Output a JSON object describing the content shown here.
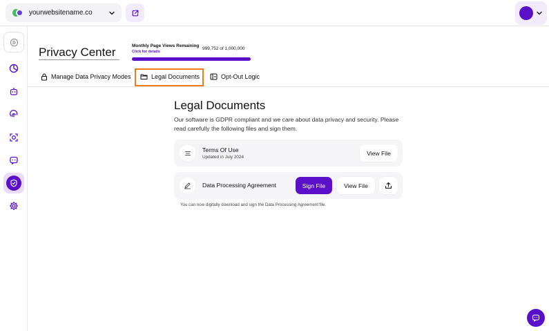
{
  "topbar": {
    "site_name": "yourwebsitename.co",
    "site_logo_icon": "two-circles-logo",
    "site_dropdown_icon": "chevron-down-icon",
    "external_link_icon": "external-link-icon",
    "account_dropdown_icon": "chevron-down-icon"
  },
  "sidebar": {
    "items": [
      {
        "icon": "collapse-icon"
      },
      {
        "icon": "pie-chart-icon"
      },
      {
        "icon": "robot-icon"
      },
      {
        "icon": "fingerprint-icon"
      },
      {
        "icon": "scan-icon"
      },
      {
        "icon": "chat-icon"
      },
      {
        "icon": "shield-check-icon",
        "active": true
      },
      {
        "icon": "gear-icon"
      }
    ]
  },
  "header": {
    "title": "Privacy Center",
    "page_views_label": "Monthly Page Views Remaining",
    "page_views_link": "Click for details",
    "page_views_count": "999,752 of 1,000,000",
    "page_views_fraction": 0.99975
  },
  "tabs": [
    {
      "label": "Manage Data Privacy Modes",
      "icon": "lock-icon"
    },
    {
      "label": "Legal Documents",
      "icon": "folder-icon",
      "active": true
    },
    {
      "label": "Opt-Out Logic",
      "icon": "toggle-panel-icon"
    }
  ],
  "main": {
    "title": "Legal Documents",
    "description": "Our software is GDPR compliant and we care about data privacy and security. Please read carefully the following files and sign them.",
    "documents": [
      {
        "title": "Terms Of Use",
        "subtitle": "Updated in July 2024",
        "icon": "lines-icon",
        "view_label": "View File"
      },
      {
        "title": "Data Processing Agreement",
        "icon": "pen-icon",
        "sign_label": "Sign File",
        "view_label": "View File",
        "upload_icon": "upload-icon"
      }
    ],
    "footnote": "You can now digitally download and sign the Data Processing Agreement file."
  },
  "colors": {
    "brand": "#5a10c8",
    "brand_light": "#f1ebfb",
    "highlight": "#f07b1a",
    "site_logo_green": "#4bb865"
  },
  "chat_fab_icon": "chat-icon"
}
